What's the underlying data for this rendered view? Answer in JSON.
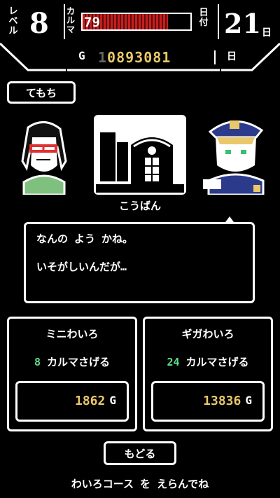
{
  "hud": {
    "level_label": "レベル",
    "level": "8",
    "karma_label": "カルマ",
    "karma": "79",
    "karma_fraction": 0.79,
    "date_label": "日付",
    "day": "21",
    "day_unit": "日",
    "money_unit": "G",
    "money_dim": "1",
    "money_lit": "0893081",
    "money_day_unit": "日"
  },
  "inventory_button": "てもち",
  "location": "こうばん",
  "dialog": {
    "line1": "なんの よう かね。",
    "line2": "いそがしいんだが…"
  },
  "courses": [
    {
      "name": "ミニわいろ",
      "karma_amount": "8",
      "karma_text": "カルマさげる",
      "price": "1862",
      "price_unit": "G"
    },
    {
      "name": "ギガわいろ",
      "karma_amount": "24",
      "karma_text": "カルマさげる",
      "price": "13836",
      "price_unit": "G"
    }
  ],
  "back_button": "もどる",
  "instruction": "わいろコース を えらんでね",
  "colors": {
    "background": "#000000",
    "karma_bar": "#c81e1e",
    "gold": "#e8c86a",
    "green": "#5de08a"
  }
}
